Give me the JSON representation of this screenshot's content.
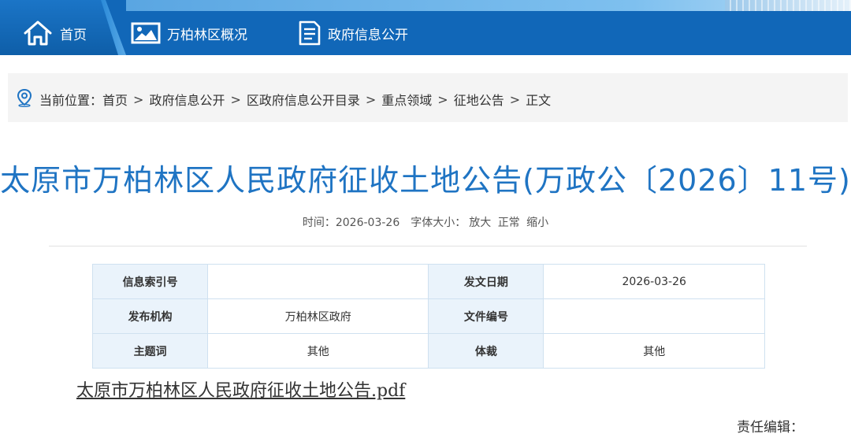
{
  "nav": {
    "items": [
      {
        "label": "首页",
        "icon": "home-icon"
      },
      {
        "label": "万柏林区概况",
        "icon": "picture-icon"
      },
      {
        "label": "政府信息公开",
        "icon": "document-icon"
      }
    ]
  },
  "breadcrumb": {
    "prefix": "当前位置：",
    "items": [
      "首页",
      "政府信息公开",
      "区政府信息公开目录",
      "重点领域",
      "征地公告",
      "正文"
    ],
    "separator": ">"
  },
  "article": {
    "title": "太原市万柏林区人民政府征收土地公告(万政公〔2026〕11号)",
    "time_label": "时间：",
    "time_value": "2026-03-26",
    "fontsize_label": "字体大小：",
    "fontsize_options": [
      "放大",
      "正常",
      "缩小"
    ],
    "info": {
      "index_no_label": "信息索引号",
      "index_no_value": "",
      "issue_date_label": "发文日期",
      "issue_date_value": "2026-03-26",
      "publisher_label": "发布机构",
      "publisher_value": "万柏林区政府",
      "doc_no_label": "文件编号",
      "doc_no_value": "",
      "keyword_label": "主题词",
      "keyword_value": "其他",
      "genre_label": "体裁",
      "genre_value": "其他"
    },
    "attachment": "太原市万柏林区人民政府征收土地公告.pdf",
    "editor_label": "责任编辑："
  }
}
